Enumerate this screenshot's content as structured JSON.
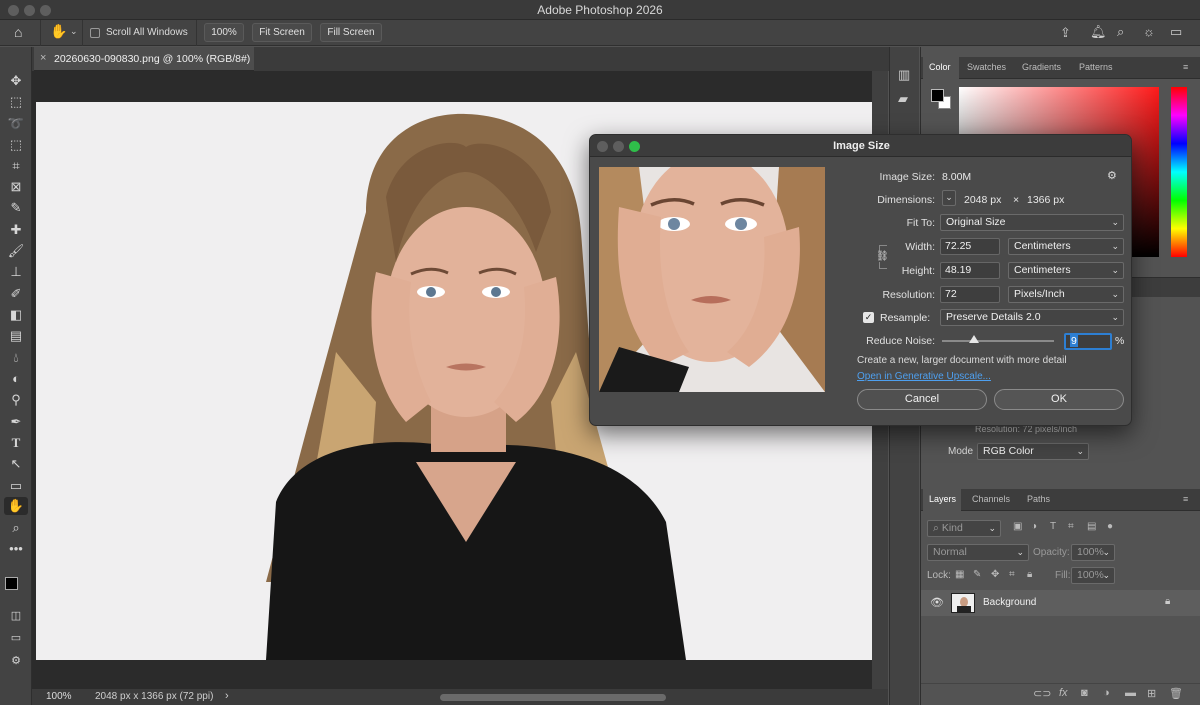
{
  "app": {
    "title": "Adobe Photoshop 2026"
  },
  "options_bar": {
    "scroll_all_windows": "Scroll All Windows",
    "zoom": "100%",
    "fit_screen": "Fit Screen",
    "fill_screen": "Fill Screen"
  },
  "document": {
    "tab_title": "20260630-090830.png @ 100% (RGB/8#)",
    "close": "×"
  },
  "status": {
    "zoom": "100%",
    "info": "2048 px x 1366 px (72 ppi)",
    "arrow": "›"
  },
  "color_panel": {
    "tabs": [
      "Color",
      "Swatches",
      "Gradients",
      "Patterns"
    ]
  },
  "properties": {
    "resolution_text": "Resolution: 72 pixels/inch",
    "mode_label": "Mode",
    "mode_value": "RGB Color"
  },
  "layers_panel": {
    "tabs": [
      "Layers",
      "Channels",
      "Paths"
    ],
    "kind_placeholder": "Kind",
    "blend_mode": "Normal",
    "opacity_label": "Opacity:",
    "opacity_value": "100%",
    "lock_label": "Lock:",
    "fill_label": "Fill:",
    "fill_value": "100%",
    "layer_name": "Background"
  },
  "dialog": {
    "title": "Image Size",
    "image_size_label": "Image Size:",
    "image_size_value": "8.00M",
    "dimensions_label": "Dimensions:",
    "dimensions_w": "2048 px",
    "dimensions_x": "×",
    "dimensions_h": "1366 px",
    "fit_to_label": "Fit To:",
    "fit_to_value": "Original Size",
    "width_label": "Width:",
    "width_value": "72.25",
    "width_unit": "Centimeters",
    "height_label": "Height:",
    "height_value": "48.19",
    "height_unit": "Centimeters",
    "resolution_label": "Resolution:",
    "resolution_value": "72",
    "resolution_unit": "Pixels/Inch",
    "resample_label": "Resample:",
    "resample_value": "Preserve Details 2.0",
    "reduce_noise_label": "Reduce Noise:",
    "reduce_noise_value": "9",
    "reduce_noise_unit": "%",
    "reduce_noise_level": 0.09,
    "hint_text": "Create a new, larger document with more detail",
    "upscale_link": "Open in Generative Upscale...",
    "cancel": "Cancel",
    "ok": "OK"
  },
  "colors": {
    "accent": "#2d7fd3",
    "link": "#4ea0f0",
    "foreground": "#000000",
    "background": "#ffffff"
  }
}
